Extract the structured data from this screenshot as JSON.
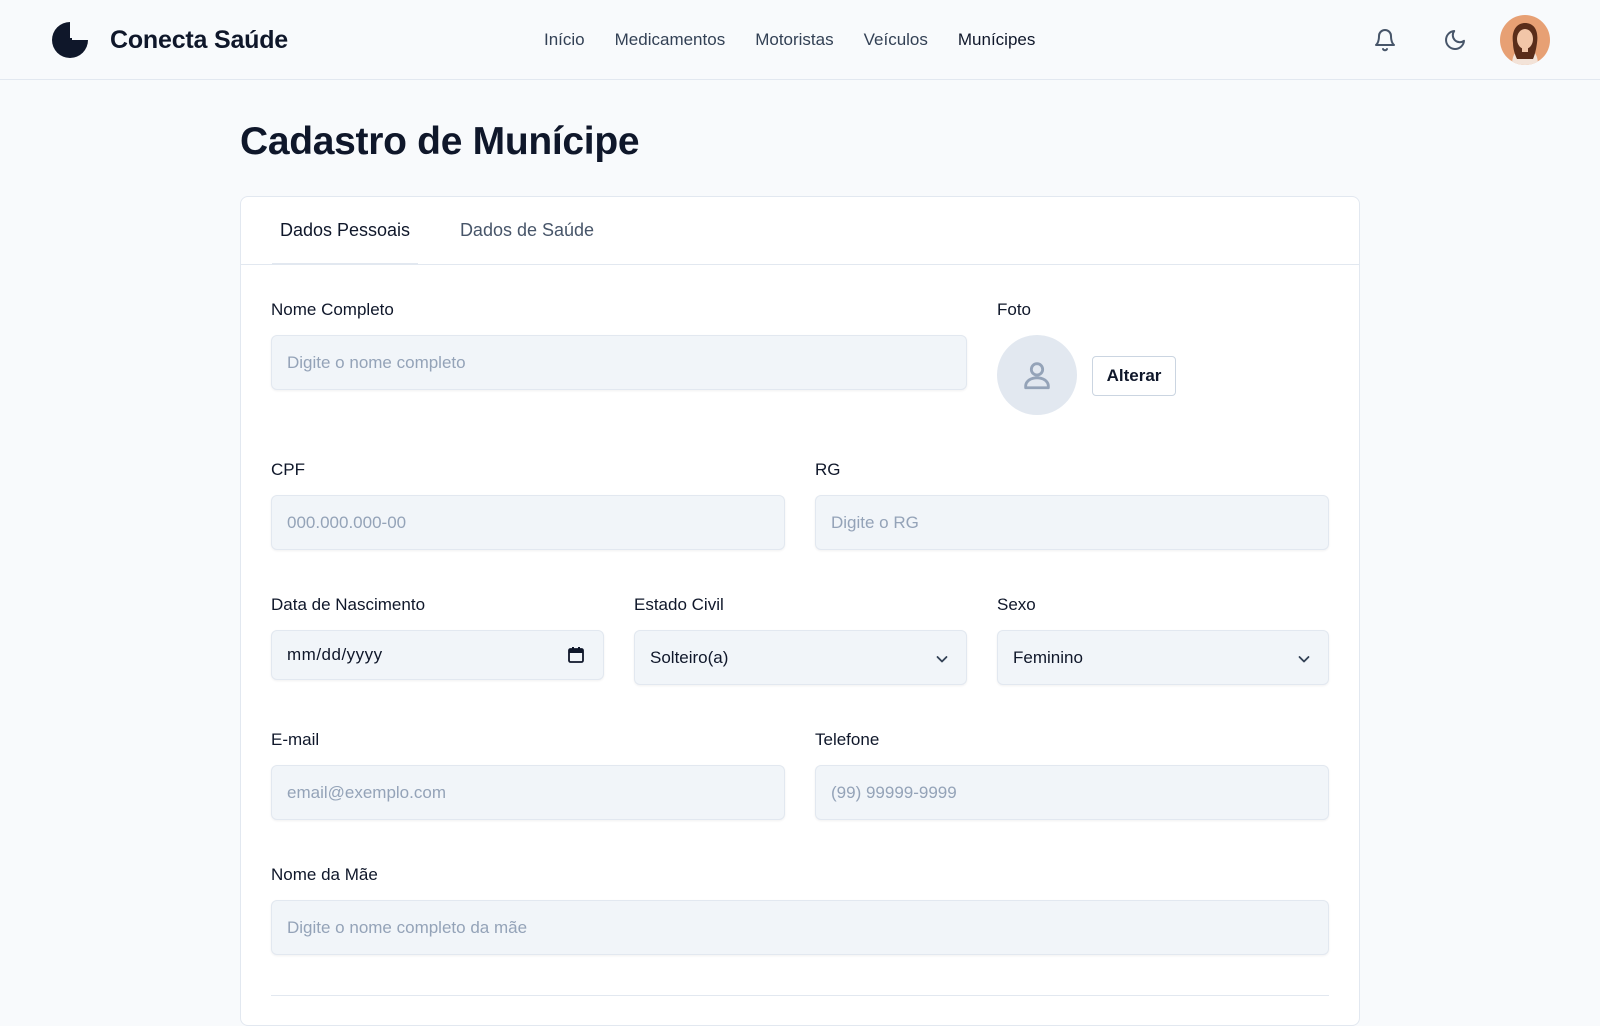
{
  "brand": {
    "name": "Conecta Saúde"
  },
  "nav": {
    "items": [
      {
        "label": "Início"
      },
      {
        "label": "Medicamentos"
      },
      {
        "label": "Motoristas"
      },
      {
        "label": "Veículos"
      },
      {
        "label": "Munícipes"
      }
    ],
    "active": "Munícipes"
  },
  "header_icons": [
    "bell-icon",
    "moon-icon"
  ],
  "page": {
    "title": "Cadastro de Munícipe"
  },
  "tabs": [
    {
      "label": "Dados Pessoais",
      "active": true
    },
    {
      "label": "Dados de Saúde",
      "active": false
    }
  ],
  "form": {
    "nome": {
      "label": "Nome Completo",
      "placeholder": "Digite o nome completo"
    },
    "foto": {
      "label": "Foto",
      "button": "Alterar"
    },
    "cpf": {
      "label": "CPF",
      "placeholder": "000.000.000-00"
    },
    "rg": {
      "label": "RG",
      "placeholder": "Digite o RG"
    },
    "nascimento": {
      "label": "Data de Nascimento",
      "placeholder": "mm/dd/yyyy"
    },
    "estado_civil": {
      "label": "Estado Civil",
      "value": "Solteiro(a)"
    },
    "sexo": {
      "label": "Sexo",
      "value": "Feminino"
    },
    "email": {
      "label": "E-mail",
      "placeholder": "email@exemplo.com"
    },
    "telefone": {
      "label": "Telefone",
      "placeholder": "(99) 99999-9999"
    },
    "mae": {
      "label": "Nome da Mãe",
      "placeholder": "Digite o nome completo da mãe"
    }
  },
  "colors": {
    "text": "#0f172a",
    "muted": "#475569",
    "placeholder": "#94a3b8",
    "input_bg": "#f1f5f9",
    "border": "#e2e8f0"
  }
}
